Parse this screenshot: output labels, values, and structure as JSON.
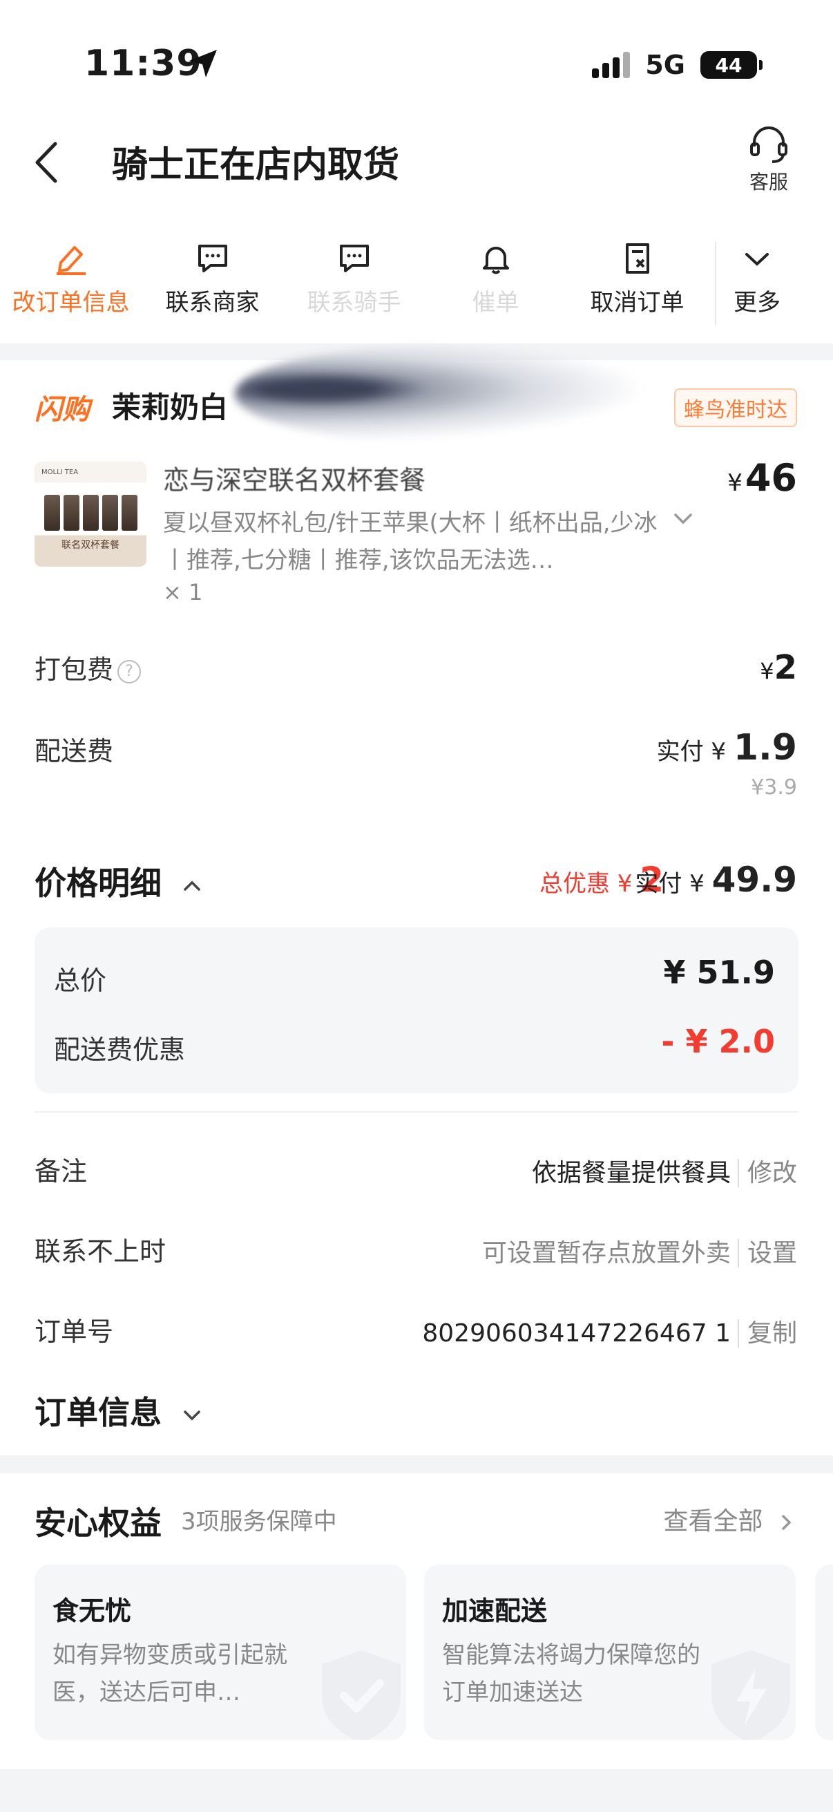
{
  "status_bar": {
    "time": "11:39",
    "network": "5G",
    "battery": "44"
  },
  "header": {
    "title": "骑士正在店内取货",
    "customer_service": "客服"
  },
  "actions": [
    {
      "label": "改订单信息",
      "icon": "edit-icon"
    },
    {
      "label": "联系商家",
      "icon": "chat-icon"
    },
    {
      "label": "联系骑手",
      "icon": "chat-icon"
    },
    {
      "label": "催单",
      "icon": "bell-icon"
    },
    {
      "label": "取消订单",
      "icon": "cancel-doc-icon"
    },
    {
      "label": "更多",
      "icon": "chevron-down-icon"
    }
  ],
  "shop": {
    "brand": "闪购",
    "name": "茉莉奶白",
    "badge": "蜂鸟准时达"
  },
  "product": {
    "name": "恋与深空联名双杯套餐",
    "price": "46",
    "currency": "¥",
    "spec": "夏以昼双杯礼包/针王苹果(大杯丨纸杯出品,少冰丨推荐,七分糖丨推荐,该饮品无法选…",
    "qty": "× 1",
    "thumb_caption": "联名双杯套餐",
    "thumb_logo": "MOLLI TEA"
  },
  "fees": {
    "pack_label": "打包费",
    "pack_value": "2",
    "delivery_label": "配送费",
    "delivery_paid_prefix": "实付",
    "delivery_paid_value": "1.9",
    "delivery_original": "¥3.9"
  },
  "price_detail": {
    "title": "价格明细",
    "discount_label": "总优惠",
    "discount_value": "2",
    "paid_label": "实付",
    "paid_value": "49.9",
    "total_label": "总价",
    "total_value": "¥ 51.9",
    "delivery_discount_label": "配送费优惠",
    "delivery_discount_value": "- ¥ 2.0"
  },
  "info": {
    "note_label": "备注",
    "note_value": "依据餐量提供餐具",
    "note_action": "修改",
    "unreachable_label": "联系不上时",
    "unreachable_value": "可设置暂存点放置外卖",
    "unreachable_action": "设置",
    "order_no_label": "订单号",
    "order_no_value": "802906034147226467 1",
    "order_no_action": "复制",
    "order_info_title": "订单信息"
  },
  "guarantee": {
    "title": "安心权益",
    "subtitle": "3项服务保障中",
    "see_all": "查看全部",
    "cards": [
      {
        "title": "食无忧",
        "desc": "如有异物变质或引起就医，送达后可申…",
        "icon": "shield-check-icon"
      },
      {
        "title": "加速配送",
        "desc": "智能算法将竭力保障您的订单加速送达",
        "icon": "lightning-shield-icon"
      }
    ]
  },
  "colors": {
    "accent": "#ff6f1f",
    "discount_red": "#f23c30",
    "panel_bg": "#f5f6f8"
  }
}
